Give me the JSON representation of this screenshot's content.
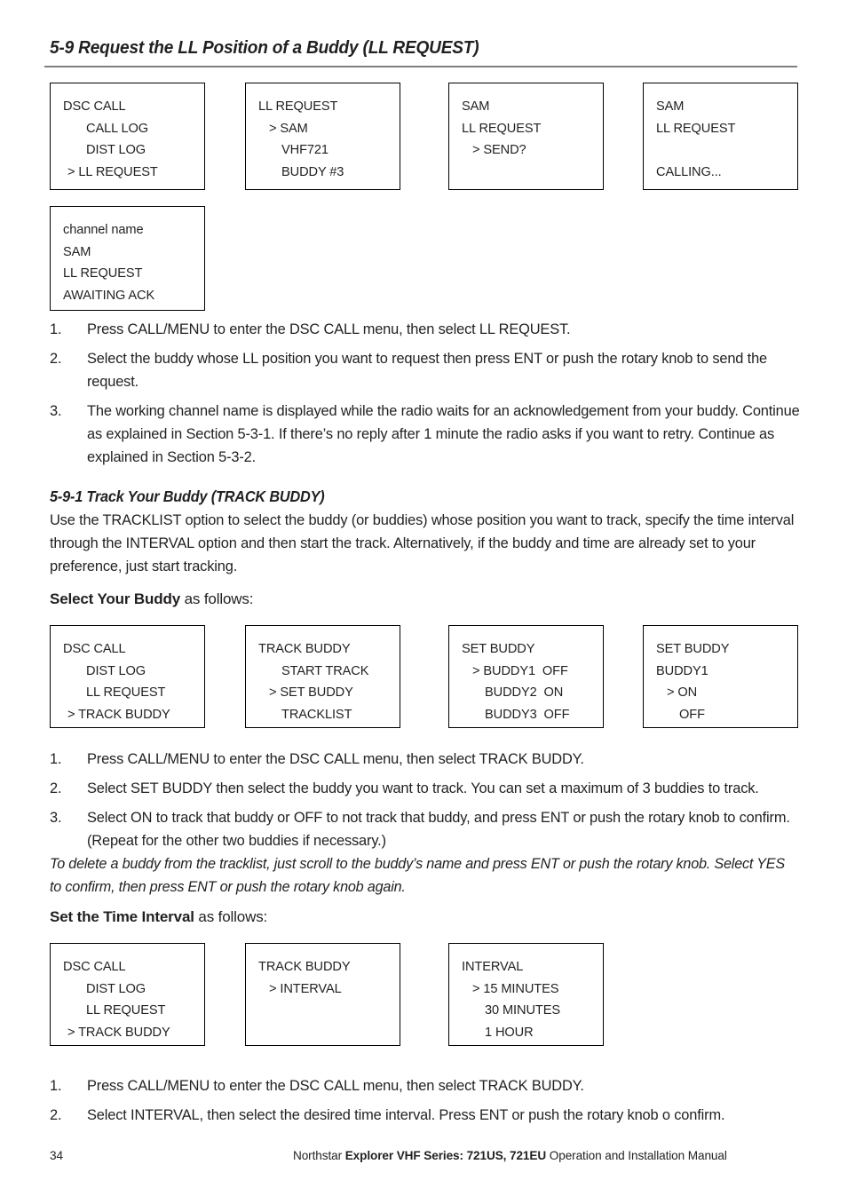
{
  "section": {
    "heading": "5-9 Request the LL Position of a Buddy (LL REQUEST)"
  },
  "screens_row1": [
    {
      "lines": [
        {
          "text": "DSC CALL",
          "style": "plain"
        },
        {
          "text": "CALL LOG",
          "style": "indent"
        },
        {
          "text": "DIST LOG",
          "style": "indent"
        },
        {
          "text": "> LL REQUEST",
          "style": "selected"
        }
      ]
    },
    {
      "lines": [
        {
          "text": "LL REQUEST",
          "style": "plain"
        },
        {
          "text": "> SAM",
          "style": "selected2"
        },
        {
          "text": "VHF721",
          "style": "indent"
        },
        {
          "text": "BUDDY #3",
          "style": "indent"
        }
      ]
    },
    {
      "lines": [
        {
          "text": "SAM",
          "style": "plain"
        },
        {
          "text": "LL REQUEST",
          "style": "plain"
        },
        {
          "text": "> SEND?",
          "style": "selected2"
        },
        {
          "text": "",
          "style": "blank"
        }
      ]
    },
    {
      "lines": [
        {
          "text": "SAM",
          "style": "plain"
        },
        {
          "text": "LL REQUEST",
          "style": "plain"
        },
        {
          "text": "",
          "style": "blank"
        },
        {
          "text": "CALLING...",
          "style": "plain"
        }
      ]
    }
  ],
  "screens_row2": [
    {
      "lines": [
        {
          "text": "channel name",
          "style": "plain"
        },
        {
          "text": "SAM",
          "style": "plain"
        },
        {
          "text": "LL REQUEST",
          "style": "plain"
        },
        {
          "text": "AWAITING ACK",
          "style": "plain"
        }
      ]
    }
  ],
  "steps_1": [
    {
      "num": "1.",
      "text": "Press CALL/MENU to enter the DSC CALL menu, then select LL REQUEST."
    },
    {
      "num": "2.",
      "text": "Select the buddy whose LL position you want to request then press ENT or push the rotary knob to send the request."
    },
    {
      "num": "3.",
      "text": "The working channel name is displayed while the radio waits for an acknowledgement from your buddy. Continue as explained in Section 5-3-1. If there’s no reply after 1 minute the radio asks if you want to retry. Continue as explained in Section 5-3-2."
    }
  ],
  "subsection": {
    "heading": "5-9-1 Track Your Buddy (TRACK BUDDY)",
    "intro": "Use the TRACKLIST option to select the buddy (or buddies) whose position you want to track, specify the time interval through the INTERVAL option and then start the track. Alternatively, if the buddy and time are already set to your preference, just start tracking."
  },
  "select_buddy": {
    "label_bold": "Select Your Buddy",
    "label_rest": " as follows:"
  },
  "screens_row3": [
    {
      "lines": [
        {
          "text": "DSC CALL",
          "style": "plain"
        },
        {
          "text": "DIST LOG",
          "style": "indent"
        },
        {
          "text": "LL REQUEST",
          "style": "indent"
        },
        {
          "text": "> TRACK BUDDY",
          "style": "selected"
        }
      ]
    },
    {
      "lines": [
        {
          "text": "TRACK BUDDY",
          "style": "plain"
        },
        {
          "text": "START TRACK",
          "style": "indent"
        },
        {
          "text": "> SET BUDDY",
          "style": "selected2"
        },
        {
          "text": "TRACKLIST",
          "style": "indent"
        }
      ]
    },
    {
      "lines": [
        {
          "text": "SET BUDDY",
          "style": "plain"
        },
        {
          "text": "> BUDDY1  OFF",
          "style": "selected2"
        },
        {
          "text": "BUDDY2  ON",
          "style": "indent"
        },
        {
          "text": "BUDDY3  OFF",
          "style": "indent"
        }
      ]
    },
    {
      "lines": [
        {
          "text": "SET BUDDY",
          "style": "plain"
        },
        {
          "text": "BUDDY1",
          "style": "plain"
        },
        {
          "text": "> ON",
          "style": "selected2"
        },
        {
          "text": "OFF",
          "style": "indent2"
        }
      ]
    }
  ],
  "steps_2": [
    {
      "num": "1.",
      "text": "Press CALL/MENU to enter the DSC CALL menu, then select TRACK BUDDY."
    },
    {
      "num": "2.",
      "text": "Select SET BUDDY then select the buddy you want to track. You can set a maximum of 3 buddies to track."
    },
    {
      "num": "3.",
      "text": "Select ON to track that buddy or OFF to not track that buddy, and press ENT or push the rotary knob to confirm. (Repeat for the other two buddies if necessary.)"
    }
  ],
  "delete_note": "To delete a buddy from the tracklist, just scroll to the buddy’s name and press ENT or push the rotary knob. Select YES to confirm, then press ENT or push the rotary knob again.",
  "set_interval": {
    "label_bold": "Set the Time Interval",
    "label_rest": " as follows:"
  },
  "screens_row4": [
    {
      "lines": [
        {
          "text": "DSC CALL",
          "style": "plain"
        },
        {
          "text": "DIST LOG",
          "style": "indent"
        },
        {
          "text": "LL REQUEST",
          "style": "indent"
        },
        {
          "text": "> TRACK BUDDY",
          "style": "selected"
        }
      ]
    },
    {
      "lines": [
        {
          "text": "TRACK BUDDY",
          "style": "plain"
        },
        {
          "text": "> INTERVAL",
          "style": "selected2"
        },
        {
          "text": "",
          "style": "blank"
        },
        {
          "text": "",
          "style": "blank"
        }
      ]
    },
    {
      "lines": [
        {
          "text": "INTERVAL",
          "style": "plain"
        },
        {
          "text": "> 15 MINUTES",
          "style": "selected2"
        },
        {
          "text": "30 MINUTES",
          "style": "indent"
        },
        {
          "text": "1 HOUR",
          "style": "indent"
        }
      ]
    }
  ],
  "steps_3": [
    {
      "num": "1.",
      "text": "Press CALL/MENU to enter the DSC CALL menu, then select TRACK BUDDY."
    },
    {
      "num": "2.",
      "text": "Select INTERVAL, then select the desired time interval. Press ENT or push the rotary knob o confirm."
    }
  ],
  "footer": {
    "page_number": "34",
    "text_pre": "Northstar ",
    "text_bold": "Explorer VHF Series: 721US, 721EU",
    "text_post": " Operation and Installation Manual"
  },
  "colors": {
    "text": "#231f20",
    "rule": "#808080",
    "box_border": "#000000"
  }
}
